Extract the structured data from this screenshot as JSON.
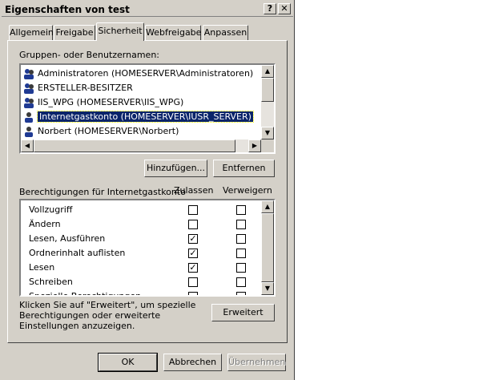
{
  "window": {
    "title": "Eigenschaften von test",
    "help_button": "?",
    "close_button": "✕"
  },
  "tabs": [
    {
      "label": "Allgemein"
    },
    {
      "label": "Freigabe"
    },
    {
      "label": "Sicherheit",
      "active": true
    },
    {
      "label": "Webfreigabe"
    },
    {
      "label": "Anpassen"
    }
  ],
  "groups": {
    "label": "Gruppen- oder Benutzernamen:",
    "items": [
      {
        "name": "Administratoren (HOMESERVER\\Administratoren)",
        "icon": "group-icon"
      },
      {
        "name": "ERSTELLER-BESITZER",
        "icon": "group-icon"
      },
      {
        "name": "IIS_WPG (HOMESERVER\\IIS_WPG)",
        "icon": "group-icon"
      },
      {
        "name": "Internetgastkonto (HOMESERVER\\IUSR_SERVER)",
        "icon": "user-icon",
        "selected": true
      },
      {
        "name": "Norbert (HOMESERVER\\Norbert)",
        "icon": "user-icon"
      }
    ],
    "add_label": "Hinzufügen...",
    "remove_label": "Entfernen"
  },
  "permissions": {
    "label": "Berechtigungen für Internetgastkonto",
    "allow_header": "Zulassen",
    "deny_header": "Verweigern",
    "rows": [
      {
        "name": "Vollzugriff",
        "allow": false,
        "deny": false
      },
      {
        "name": "Ändern",
        "allow": false,
        "deny": false
      },
      {
        "name": "Lesen, Ausführen",
        "allow": true,
        "deny": false
      },
      {
        "name": "Ordnerinhalt auflisten",
        "allow": true,
        "deny": false
      },
      {
        "name": "Lesen",
        "allow": true,
        "deny": false
      },
      {
        "name": "Schreiben",
        "allow": false,
        "deny": false
      },
      {
        "name": "Spezielle Berechtigungen",
        "allow": false,
        "deny": false
      }
    ]
  },
  "advanced": {
    "text": "Klicken Sie auf \"Erweitert\", um spezielle Berechtigungen oder erweiterte Einstellungen anzuzeigen.",
    "button": "Erweitert"
  },
  "footer": {
    "ok": "OK",
    "cancel": "Abbrechen",
    "apply": "Übernehmen"
  },
  "colors": {
    "face": "#d4d0c8",
    "selection": "#0a246a"
  }
}
